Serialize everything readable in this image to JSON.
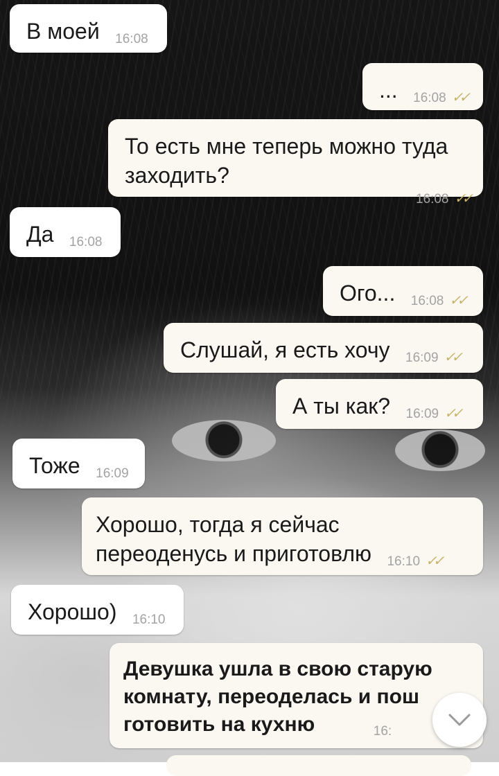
{
  "messages": [
    {
      "text": "В моей",
      "time": "16:08"
    },
    {
      "text": "...",
      "time": "16:08",
      "status": "read"
    },
    {
      "text": "То есть мне теперь можно туда заходить?",
      "time": "16:08",
      "status": "read"
    },
    {
      "text": "Да",
      "time": "16:08"
    },
    {
      "text": "Ого...",
      "time": "16:08",
      "status": "read"
    },
    {
      "text": "Слушай, я есть хочу",
      "time": "16:09",
      "status": "read"
    },
    {
      "text": "А ты как?",
      "time": "16:09",
      "status": "read"
    },
    {
      "text": "Тоже",
      "time": "16:09"
    },
    {
      "text": "Хорошо, тогда я сейчас переоденусь и приготовлю",
      "time": "16:10",
      "status": "read"
    },
    {
      "text": "Хорошо)",
      "time": "16:10"
    },
    {
      "text": "Девушка ушла в свою старую комнату, переоделась и пош",
      "text_line2": "готовить на кухню",
      "time": "16:"
    }
  ],
  "theme": {
    "incoming_bubble": "#ffffff",
    "outgoing_bubble": "#fbf8f2",
    "read_ticks": "#c7b46a",
    "time_text": "#a3a3a3"
  },
  "icons": {
    "read_status": "double-check-icon",
    "scroll_down": "chevron-down-icon"
  }
}
